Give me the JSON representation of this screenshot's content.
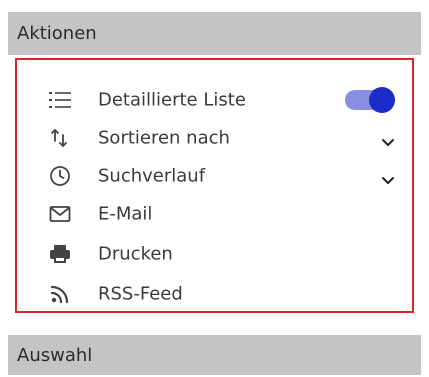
{
  "sections": {
    "actions_title": "Aktionen",
    "selection_title": "Auswahl"
  },
  "actions": [
    {
      "label": "Detaillierte Liste",
      "icon": "list-icon",
      "control": "toggle",
      "toggle_on": true
    },
    {
      "label": "Sortieren nach",
      "icon": "sort-arrows-icon",
      "control": "dropdown"
    },
    {
      "label": "Suchverlauf",
      "icon": "clock-icon",
      "control": "dropdown"
    },
    {
      "label": "E-Mail",
      "icon": "mail-icon"
    },
    {
      "label": "Drucken",
      "icon": "printer-icon"
    },
    {
      "label": "RSS-Feed",
      "icon": "rss-icon"
    }
  ],
  "colors": {
    "header_bg": "#c4c4c4",
    "highlight_border": "#d9262b",
    "toggle_track": "#8a8ee2",
    "toggle_knob": "#1c2cc8"
  }
}
